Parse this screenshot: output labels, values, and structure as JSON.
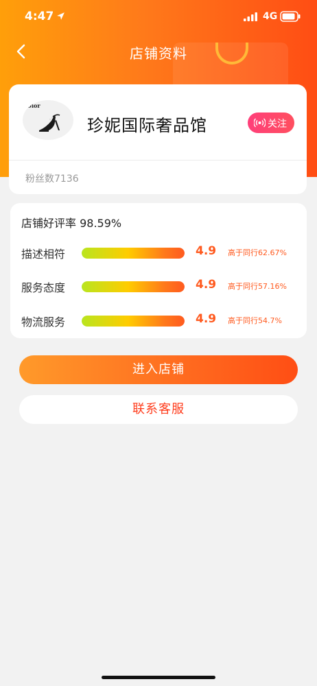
{
  "status_bar": {
    "time": "4:47",
    "network": "4G",
    "icons": [
      "location-arrow-icon",
      "signal-bars-icon",
      "battery-icon"
    ]
  },
  "nav": {
    "title": "店铺资料",
    "back_icon": "chevron-left-icon"
  },
  "store": {
    "logo_text": "Dior",
    "name": "珍妮国际奢品馆",
    "follow_label": "关注",
    "follow_icon": "broadcast-icon",
    "fans": "粉丝数7136"
  },
  "ratings": {
    "title": "店铺好评率 98.59%",
    "items": [
      {
        "label": "描述相符",
        "score": "4.9",
        "compare": "高于同行62.67%",
        "bar_fraction": 1.0
      },
      {
        "label": "服务态度",
        "score": "4.9",
        "compare": "高于同行57.16%",
        "bar_fraction": 1.0
      },
      {
        "label": "物流服务",
        "score": "4.9",
        "compare": "高于同行54.7%",
        "bar_fraction": 1.0
      }
    ]
  },
  "actions": {
    "enter_store": "进入店铺",
    "contact_service": "联系客服"
  },
  "colors": {
    "accent_orange": "#ff6a1f",
    "hero_start": "#ff9f0a",
    "hero_end": "#ff4d14",
    "follow_pink": "#ff3f7a",
    "score_orange": "#ff5a1f",
    "contact_red": "#ff3c1c"
  }
}
